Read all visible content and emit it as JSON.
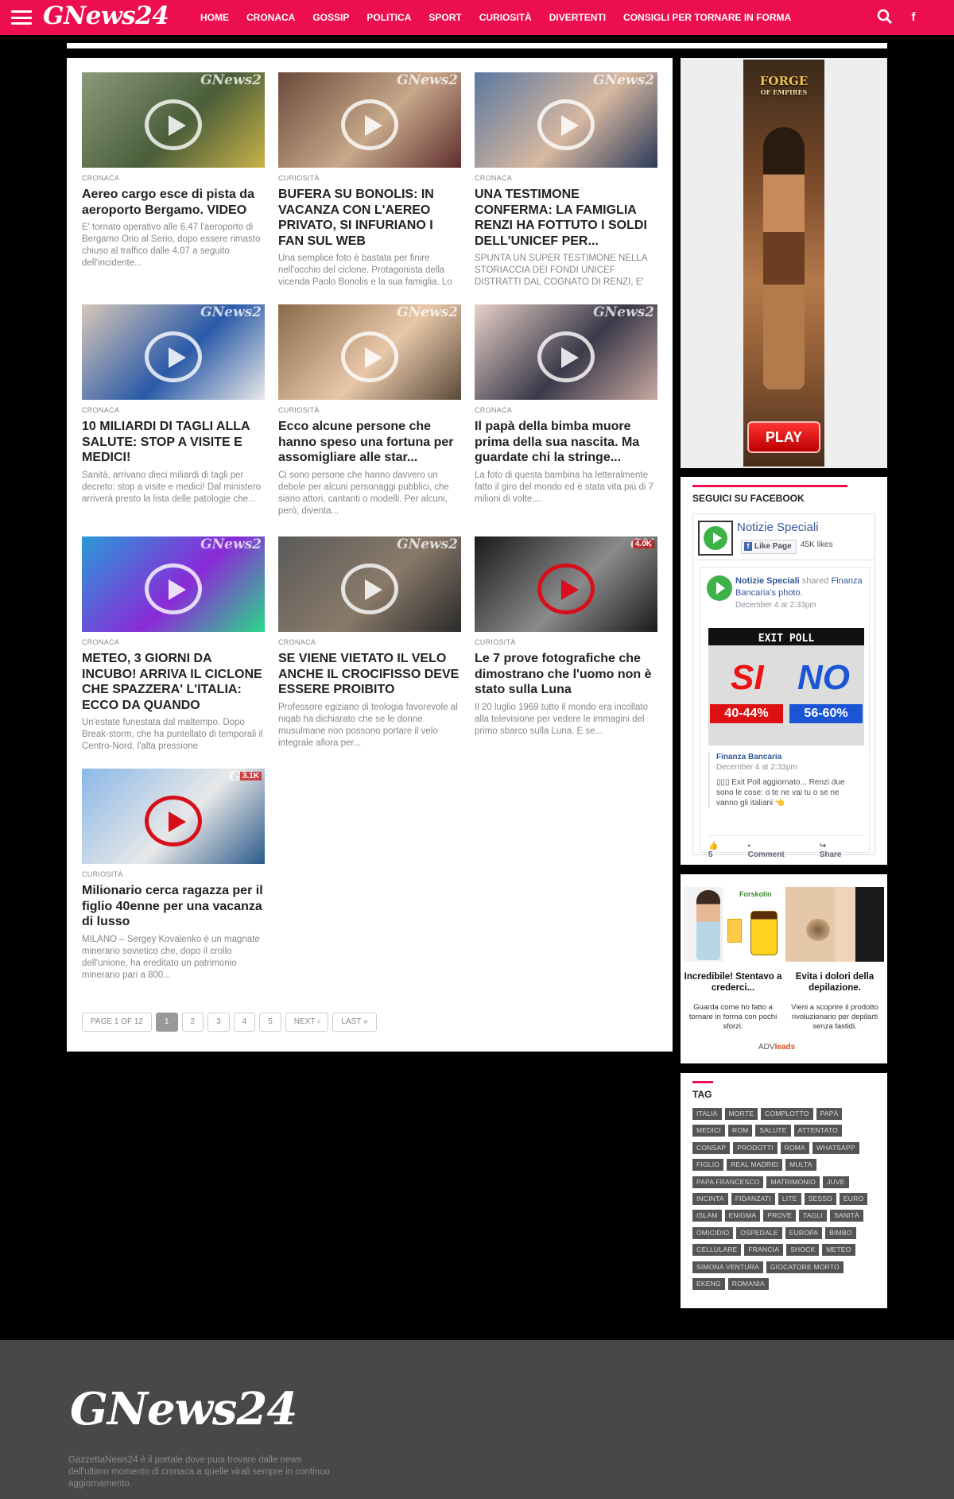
{
  "site": {
    "logo": "GNews24",
    "menu": [
      "HOME",
      "CRONACA",
      "GOSSIP",
      "POLITICA",
      "SPORT",
      "CURIOSITÀ",
      "DIVERTENTI",
      "CONSIGLI PER TORNARE IN FORMA"
    ],
    "icons": {
      "search": "search-icon",
      "facebook": "facebook-icon",
      "menu": "hamburger-icon"
    },
    "accent_color": "#ec0e4f"
  },
  "articles": [
    {
      "category": "CRONACA",
      "title": "Aereo cargo esce di pista da aeroporto Bergamo. VIDEO",
      "excerpt": "E' tornato operativo alle 6.47 l'aeroporto di Bergamo Orio al Serio, dopo essere rimasto chiuso al traffico dalle 4.07 a seguito dell'incidente...",
      "watermark": "GNews2",
      "views": "",
      "thumb_colors": [
        "#8a9a7a",
        "#4a5e3a",
        "#c9b24a"
      ],
      "play_style": "white"
    },
    {
      "category": "CURIOSITÀ",
      "title": "BUFERA SU BONOLIS: IN VACANZA CON L'AEREO PRIVATO, SI INFURIANO I FAN SUL WEB",
      "excerpt": "Una semplice foto è bastata per finire nell'occhio del ciclone. Protagonista della vicenda Paolo Bonolis e la sua famiglia. Lo",
      "watermark": "GNews2",
      "views": "",
      "thumb_colors": [
        "#6a4a3a",
        "#c8a88a",
        "#5e2e2e"
      ],
      "play_style": "white"
    },
    {
      "category": "CRONACA",
      "title": "UNA TESTIMONE CONFERMA: LA FAMIGLIA RENZI HA FOTTUTO I SOLDI DELL'UNICEF PER...",
      "excerpt": "SPUNTA UN SUPER TESTIMONE NELLA STORIACCIA DEI FONDI UNICEF DISTRATTI DAL COGNATO DI RENZI, E'",
      "watermark": "GNews2",
      "views": "",
      "thumb_colors": [
        "#5a78a0",
        "#d8b8a0",
        "#2a3a5a"
      ],
      "play_style": "white"
    },
    {
      "category": "CRONACA",
      "title": "10 MILIARDI DI TAGLI ALLA SALUTE: STOP A VISITE E MEDICI!",
      "excerpt": "Sanità, arrivano dieci miliardi di tagli per decreto: stop a visite e medici! Dal ministero arriverà presto la lista delle patologie che...",
      "watermark": "GNews2",
      "views": "",
      "thumb_colors": [
        "#d8c8b8",
        "#2a5aa8",
        "#e8e8e8"
      ],
      "play_style": "white"
    },
    {
      "category": "CURIOSITÀ",
      "title": "Ecco alcune persone che hanno speso una fortuna per assomigliare alle star...",
      "excerpt": "Ci sono persone che hanno davvero un debole per alcuni personaggi pubblici, che siano attori, cantanti o modelli. Per alcuni, però, diventa...",
      "watermark": "GNews2",
      "views": "",
      "thumb_colors": [
        "#8a6a4a",
        "#e8c8a8",
        "#5a4a3a"
      ],
      "play_style": "white"
    },
    {
      "category": "CRONACA",
      "title": "Il papà della bimba muore prima della sua nascita. Ma guardate chi la stringe...",
      "excerpt": "La foto di questa bambina ha letteralmente fatto il giro del mondo ed è stata vita più di 7 milioni di volte....",
      "watermark": "GNews2",
      "views": "",
      "thumb_colors": [
        "#e8d0c8",
        "#3a3a4a",
        "#c8a8a0"
      ],
      "play_style": "white"
    },
    {
      "category": "CRONACA",
      "title": "METEO, 3 GIORNI DA INCUBO! ARRIVA IL CICLONE CHE SPAZZERA' L'ITALIA: ECCO DA QUANDO",
      "excerpt": "Un'estate funestata dal maltempo. Dopo Break-storm, che ha puntellato di temporali il Centro-Nord, l'alta pressione",
      "watermark": "GNews2",
      "views": "",
      "thumb_colors": [
        "#2a9ad8",
        "#8a2ad8",
        "#2ad88a"
      ],
      "play_style": "white"
    },
    {
      "category": "CRONACA",
      "title": "SE VIENE VIETATO IL VELO ANCHE IL CROCIFISSO DEVE ESSERE PROIBITO",
      "excerpt": "Professore egiziano di teologia favorevole al niqab ha dichiarato che se le donne musulmane non possono portare il velo integrale allora per...",
      "watermark": "GNews2",
      "views": "",
      "thumb_colors": [
        "#5a5a5a",
        "#8a7a6a",
        "#2a2a2a"
      ],
      "play_style": "white"
    },
    {
      "category": "CURIOSITÀ",
      "title": "Le 7 prove fotografiche che dimostrano che l'uomo non è stato sulla Luna",
      "excerpt": "Il 20 luglio 1969 tutto il mondo era incollato alla televisione per vedere le immagini del primo sbarco sulla Luna. E se...",
      "watermark": "GN",
      "views": "4.0K",
      "thumb_colors": [
        "#1a1a1a",
        "#8a8a8a",
        "#1a1a1a"
      ],
      "play_style": "red"
    },
    {
      "category": "CURIOSITÀ",
      "title": "Milionario cerca ragazza per il figlio 40enne per una vacanza di lusso",
      "excerpt": "MILANO – Sergey Kovalenko è un magnate minerario sovietico che, dopo il crollo dell'unione, ha ereditato un patrimonio minerario pari a 800...",
      "watermark": "GNe",
      "views": "3.1K",
      "thumb_colors": [
        "#8ab8e8",
        "#e8e8e8",
        "#2a5a8a"
      ],
      "play_style": "red"
    }
  ],
  "pagination": {
    "info": "PAGE 1 OF 12",
    "pages": [
      "1",
      "2",
      "3",
      "4",
      "5"
    ],
    "next": "NEXT ›",
    "last": "LAST »"
  },
  "sidebar": {
    "game_ad": {
      "title": "FORGE",
      "subtitle": "OF EMPIRES",
      "button": "PLAY"
    },
    "facebook": {
      "heading": "SEGUICI SU FACEBOOK",
      "page_name": "Notizie Speciali",
      "like_button": "Like Page",
      "likes": "45K likes",
      "post_author": "Notizie Speciali",
      "post_action": "shared",
      "shared_from": "Finanza Bancaria",
      "shared_obj": "'s photo.",
      "post_date": "December 4 at 2:33pm",
      "image_title": "EXIT POLL",
      "image_si": "SI",
      "image_no": "NO",
      "image_si_pct": "40-44%",
      "image_no_pct": "56-60%",
      "shared_name": "Finanza Bancaria",
      "shared_date": "December 4 at 2:33pm",
      "shared_text": "▯▯▯ Exit Poll aggiornato... Renzi due sono le cose: o te ne vai tu o se ne vanno gli italiani 👈",
      "likes_count": "5",
      "comment": "Comment",
      "share": "Share"
    },
    "ads": [
      {
        "title": "Incredibile! Stentavo a crederci...",
        "desc": "Guarda come ho fatto a tornare in forma con pochi sforzi.",
        "brand": "Forskolin"
      },
      {
        "title": "Evita i dolori della depilazione.",
        "desc": "Vieni a scoprire il prodotto rivoluzionario per depilarti senza fastidi."
      }
    ],
    "ad_network": {
      "prefix": "ADV",
      "suffix": "leads"
    },
    "tags_heading": "TAG",
    "tags": [
      "ITALIA",
      "MORTE",
      "COMPLOTTO",
      "PAPÀ",
      "MEDICI",
      "ROM",
      "SALUTE",
      "ATTENTATO",
      "CONSAP",
      "PRODOTTI",
      "ROMA",
      "WHATSAPP",
      "FIGLIO",
      "REAL MADRID",
      "MULTA",
      "PAPA FRANCESCO",
      "MATRIMONIO",
      "JUVE",
      "INCINTA",
      "FIDANZATI",
      "LITE",
      "SESSO",
      "EURO",
      "ISLAM",
      "ENIGMA",
      "PROVE",
      "TAGLI",
      "SANITÀ",
      "OMICIDIO",
      "OSPEDALE",
      "EUROPA",
      "BIMBO",
      "CELLULARE",
      "FRANCIA",
      "SHOCK",
      "METEO",
      "SIMONA VENTURA",
      "GIOCATORE MORTO",
      "EKENG",
      "ROMANIA"
    ]
  },
  "footer": {
    "logo": "GNews24",
    "description": "GazzettaNews24 è il portale dove puoi trovare dalle news dell'ultimo momento di cronaca a quelle virali sempre in continuo aggiornamento."
  }
}
